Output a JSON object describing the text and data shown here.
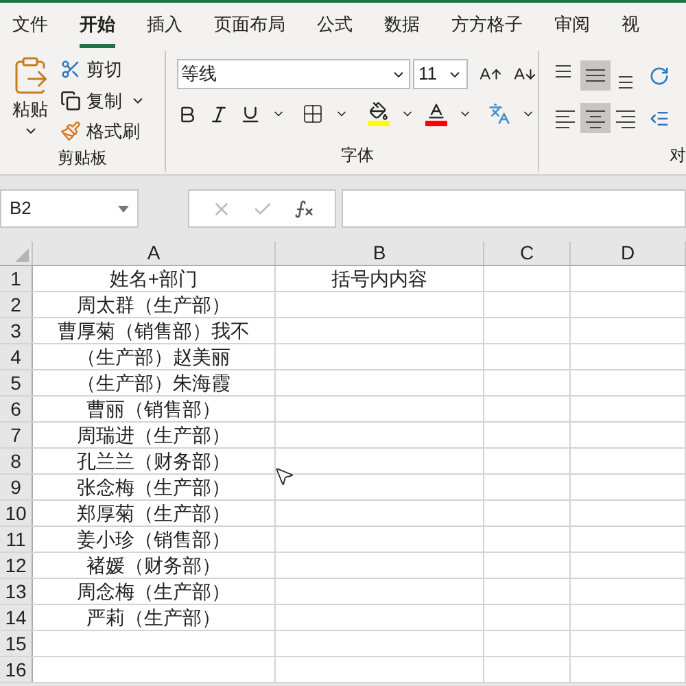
{
  "tabs": [
    {
      "label": "文件",
      "selected": false
    },
    {
      "label": "开始",
      "selected": true
    },
    {
      "label": "插入",
      "selected": false
    },
    {
      "label": "页面布局",
      "selected": false
    },
    {
      "label": "公式",
      "selected": false
    },
    {
      "label": "数据",
      "selected": false
    },
    {
      "label": "方方格子",
      "selected": false
    },
    {
      "label": "审阅",
      "selected": false
    },
    {
      "label": "视",
      "selected": false
    }
  ],
  "clipboard": {
    "paste": "粘贴",
    "cut": "剪切",
    "copy": "复制",
    "format_painter": "格式刷",
    "title": "剪贴板"
  },
  "font": {
    "name": "等线",
    "size": "11",
    "title": "字体"
  },
  "alignment": {
    "title": "对"
  },
  "formula_bar": {
    "name_box": "B2"
  },
  "sheet": {
    "columns": [
      "A",
      "B",
      "C",
      "D"
    ],
    "rows": [
      {
        "number": "1",
        "cells": [
          "姓名+部门",
          "括号内内容"
        ]
      },
      {
        "number": "2",
        "cells": [
          "周太群（生产部）"
        ]
      },
      {
        "number": "3",
        "cells": [
          "曹厚菊（销售部）我不"
        ]
      },
      {
        "number": "4",
        "cells": [
          "（生产部）赵美丽"
        ]
      },
      {
        "number": "5",
        "cells": [
          "（生产部）朱海霞"
        ]
      },
      {
        "number": "6",
        "cells": [
          "曹丽（销售部）"
        ]
      },
      {
        "number": "7",
        "cells": [
          "周瑞进（生产部）"
        ]
      },
      {
        "number": "8",
        "cells": [
          "孔兰兰（财务部）"
        ]
      },
      {
        "number": "9",
        "cells": [
          "张念梅（生产部）"
        ]
      },
      {
        "number": "10",
        "cells": [
          "郑厚菊（生产部）"
        ]
      },
      {
        "number": "11",
        "cells": [
          "姜小珍（销售部）"
        ]
      },
      {
        "number": "12",
        "cells": [
          "褚媛（财务部）"
        ]
      },
      {
        "number": "13",
        "cells": [
          "周念梅（生产部）"
        ]
      },
      {
        "number": "14",
        "cells": [
          "严莉（生产部）"
        ]
      },
      {
        "number": "15",
        "cells": []
      },
      {
        "number": "16",
        "cells": []
      }
    ]
  }
}
